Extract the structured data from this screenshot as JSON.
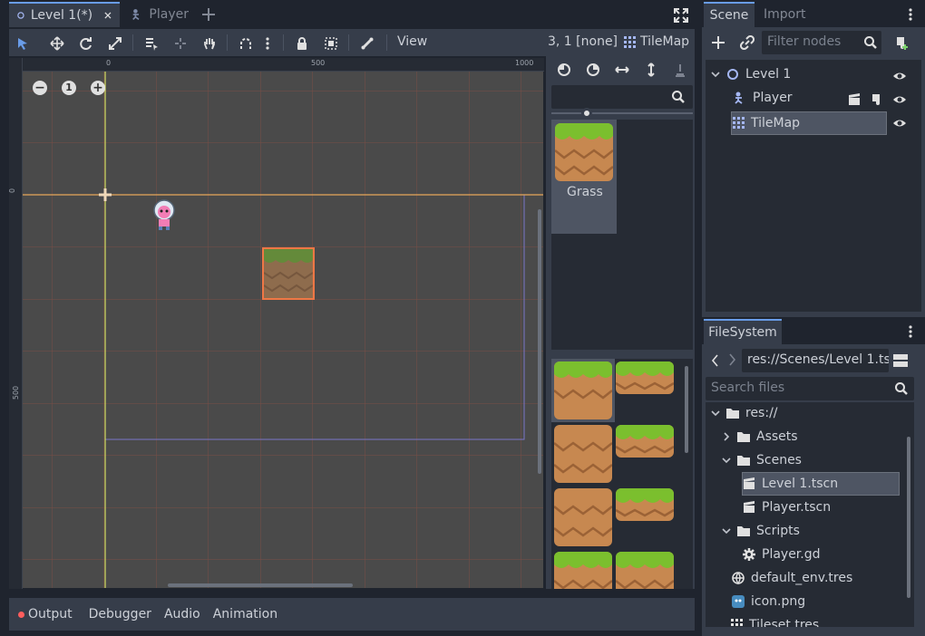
{
  "tabs": [
    {
      "label": "Level 1(*)",
      "icon": "scene-circle-icon"
    },
    {
      "label": "Player",
      "icon": "kinematic-body-icon"
    }
  ],
  "toolbar": {
    "view_label": "View",
    "coords_label": "3, 1 [none]",
    "node_label": "TileMap"
  },
  "viewport": {
    "zoom_out": "−",
    "zoom_reset": "1",
    "zoom_in": "+",
    "ruler_h": [
      "0",
      "500",
      "1000"
    ],
    "ruler_v": [
      "0",
      "500"
    ]
  },
  "palette": {
    "search_placeholder": "",
    "tile_name": "Grass"
  },
  "scene_dock": {
    "tab_scene": "Scene",
    "tab_import": "Import",
    "filter_placeholder": "Filter nodes",
    "nodes": [
      {
        "label": "Level 1",
        "icon": "node2d-circle-icon"
      },
      {
        "label": "Player",
        "icon": "kinematic-body-icon"
      },
      {
        "label": "TileMap",
        "icon": "tilemap-icon"
      }
    ]
  },
  "filesystem": {
    "title": "FileSystem",
    "path": "res://Scenes/Level 1.ts",
    "search_placeholder": "Search files",
    "items": [
      {
        "label": "res://"
      },
      {
        "label": "Assets"
      },
      {
        "label": "Scenes"
      },
      {
        "label": "Level 1.tscn"
      },
      {
        "label": "Player.tscn"
      },
      {
        "label": "Scripts"
      },
      {
        "label": "Player.gd"
      },
      {
        "label": "default_env.tres"
      },
      {
        "label": "icon.png"
      },
      {
        "label": "Tileset.tres"
      }
    ]
  },
  "bottom_panel": {
    "tabs": [
      "Output",
      "Debugger",
      "Audio",
      "Animation"
    ]
  },
  "colors": {
    "accent": "#699ce8",
    "background": "#1f242e",
    "panel": "#363d4a",
    "grass": "#7bbf2e",
    "dirt": "#c78850",
    "selection": "#ef7745"
  }
}
